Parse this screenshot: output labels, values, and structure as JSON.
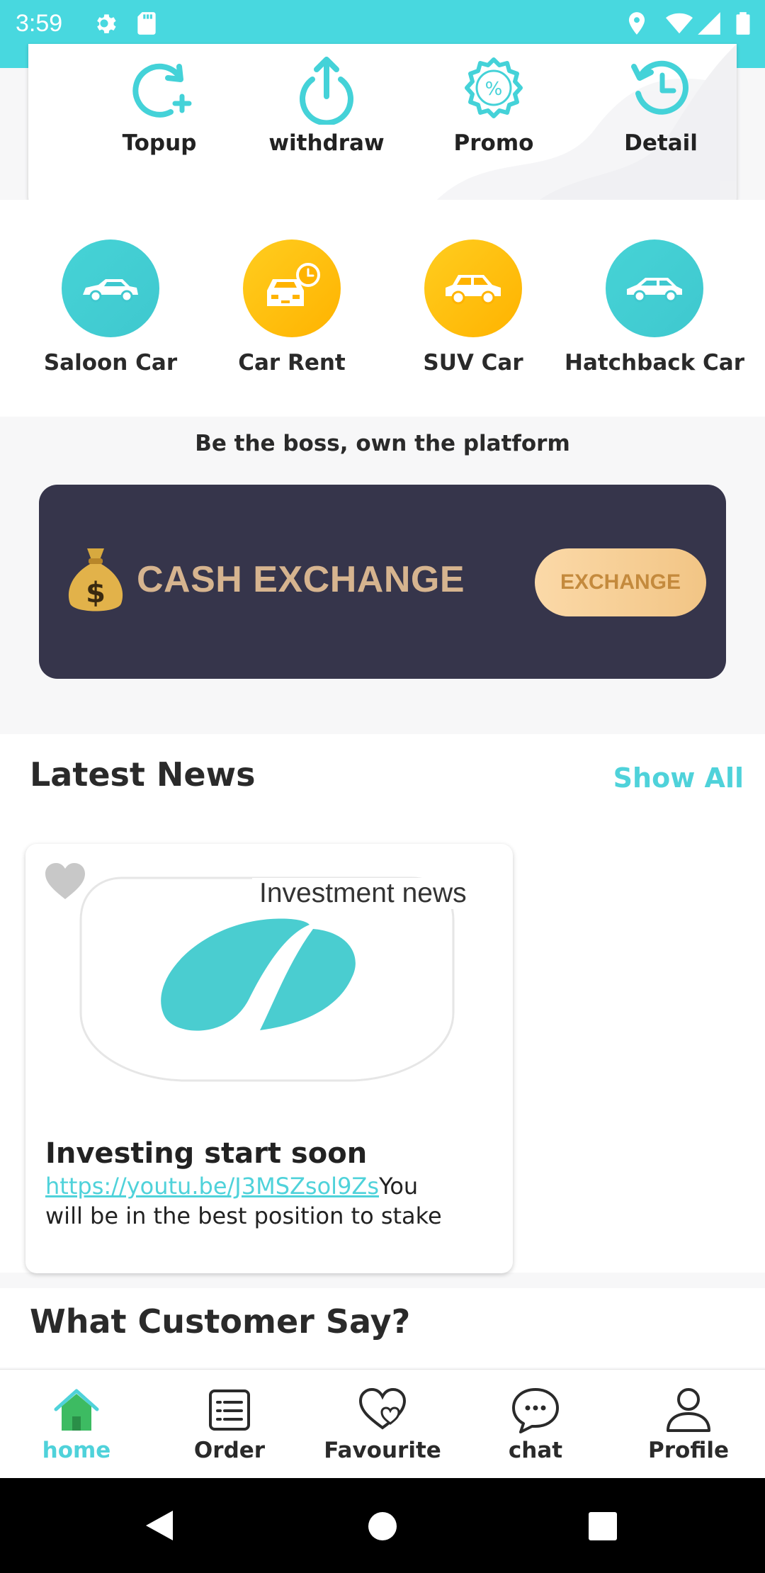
{
  "status_bar": {
    "time": "3:59"
  },
  "wallet_actions": [
    {
      "label": "Topup",
      "icon": "topup-icon"
    },
    {
      "label": "withdraw",
      "icon": "withdraw-icon"
    },
    {
      "label": "Promo",
      "icon": "promo-icon"
    },
    {
      "label": "Detail",
      "icon": "history-icon"
    }
  ],
  "categories": [
    {
      "label": "Saloon Car",
      "color": "#46d3d6",
      "icon": "saloon-car-icon"
    },
    {
      "label": "Car Rent",
      "color": "#ffc107",
      "icon": "car-rent-icon"
    },
    {
      "label": "SUV Car",
      "color": "#ffc107",
      "icon": "suv-car-icon"
    },
    {
      "label": "Hatchback Car",
      "color": "#46d3d6",
      "icon": "hatchback-car-icon"
    }
  ],
  "tagline": "Be the boss, own the platform",
  "banner": {
    "title": "CASH EXCHANGE",
    "button": "EXCHANGE"
  },
  "news": {
    "title": "Latest News",
    "show_all": "Show All",
    "item": {
      "thumb_caption": "Investment news",
      "title": "Investing start soon",
      "link": "https://youtu.be/J3MSZsol9Zs",
      "body_line1_rest": "You",
      "body_line2": "will be in the best position to stake"
    }
  },
  "customer": {
    "title": "What Customer Say?"
  },
  "bottom_nav": [
    {
      "label": "home",
      "active": true
    },
    {
      "label": "Order",
      "active": false
    },
    {
      "label": "Favourite",
      "active": false
    },
    {
      "label": "chat",
      "active": false
    },
    {
      "label": "Profile",
      "active": false
    }
  ],
  "colors": {
    "accent": "#48d8df",
    "banner_bg": "#36354b",
    "banner_gold": "#d6b48f"
  }
}
